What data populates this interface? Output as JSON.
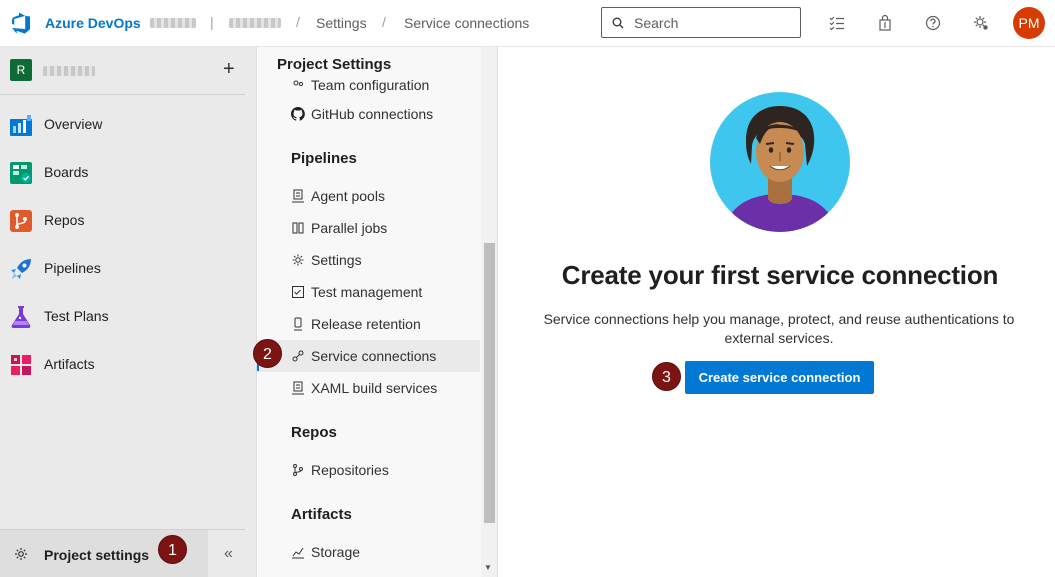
{
  "header": {
    "brand": "Azure DevOps",
    "breadcrumbs": [
      "Settings",
      "Service connections"
    ],
    "search_placeholder": "Search",
    "avatar_initials": "PM",
    "avatar_color": "#d83b01"
  },
  "project": {
    "badge": "R",
    "badge_color": "#0e6b36"
  },
  "left_nav": {
    "items": [
      {
        "label": "Overview",
        "icon": "overview-icon"
      },
      {
        "label": "Boards",
        "icon": "boards-icon"
      },
      {
        "label": "Repos",
        "icon": "repos-icon"
      },
      {
        "label": "Pipelines",
        "icon": "pipelines-icon"
      },
      {
        "label": "Test Plans",
        "icon": "test-plans-icon"
      },
      {
        "label": "Artifacts",
        "icon": "artifacts-icon"
      }
    ],
    "project_settings_label": "Project settings"
  },
  "settings_pane": {
    "title": "Project Settings",
    "partial_item": "Team configuration",
    "github_item": "GitHub connections",
    "sections": {
      "pipelines": "Pipelines",
      "repos": "Repos",
      "artifacts": "Artifacts"
    },
    "pipelines_items": [
      "Agent pools",
      "Parallel jobs",
      "Settings",
      "Test management",
      "Release retention",
      "Service connections",
      "XAML build services"
    ],
    "repos_items": [
      "Repositories"
    ],
    "artifacts_items": [
      "Storage"
    ],
    "selected_item": "Service connections"
  },
  "main": {
    "title": "Create your first service connection",
    "description": "Service connections help you manage, protect, and reuse authentications to external services.",
    "button_label": "Create service connection",
    "accent_color": "#0078d4"
  },
  "steps": [
    "1",
    "2",
    "3"
  ]
}
